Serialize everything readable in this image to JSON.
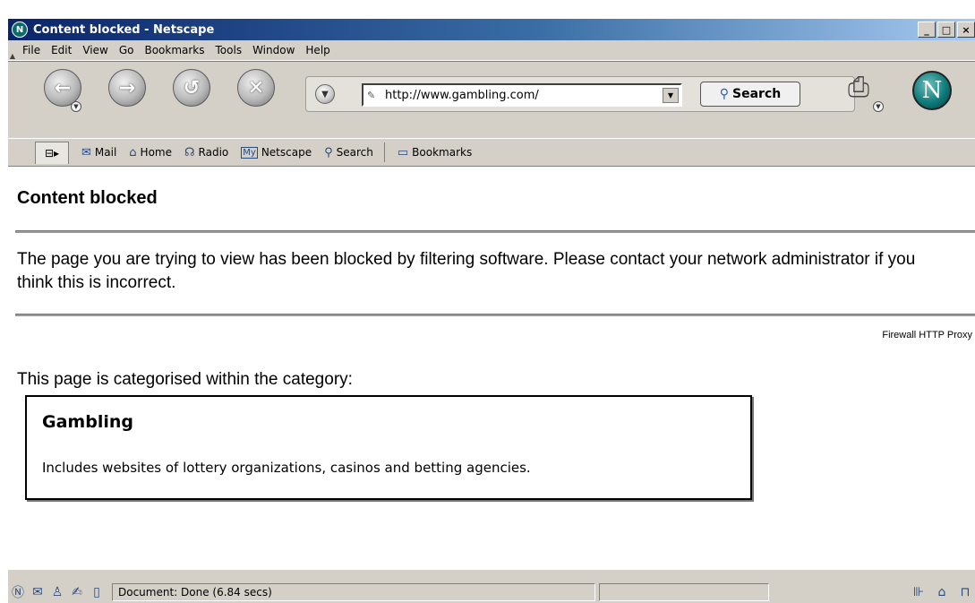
{
  "window": {
    "title": "Content blocked - Netscape",
    "controls": {
      "minimize": "_",
      "maximize": "□",
      "close": "×"
    }
  },
  "menu": [
    "File",
    "Edit",
    "View",
    "Go",
    "Bookmarks",
    "Tools",
    "Window",
    "Help"
  ],
  "navigation": {
    "back_icon": "left-arrow-icon",
    "forward_icon": "right-arrow-icon",
    "reload_icon": "reload-icon",
    "stop_icon": "stop-x-icon",
    "url": "http://www.gambling.com/",
    "search_label": "Search"
  },
  "personal_toolbar": {
    "tab_icon": "⊟▸",
    "items": [
      {
        "label": "Mail",
        "icon": "✉"
      },
      {
        "label": "Home",
        "icon": "⌂"
      },
      {
        "label": "Radio",
        "icon": "☊"
      },
      {
        "label": "Netscape",
        "icon": "My"
      },
      {
        "label": "Search",
        "icon": "⚲"
      },
      {
        "label": "Bookmarks",
        "icon": "▭"
      }
    ]
  },
  "content": {
    "title": "Content blocked",
    "message": "The page you are trying to view has been blocked by filtering software. Please contact your network administrator if you think this is incorrect.",
    "proxy_label": "Firewall HTTP Proxy",
    "category_intro": "This page is categorised within the category:",
    "category_name": "Gambling",
    "category_description": "Includes websites of lottery organizations, casinos and betting agencies."
  },
  "status": {
    "text": "Document: Done (6.84 secs)"
  }
}
